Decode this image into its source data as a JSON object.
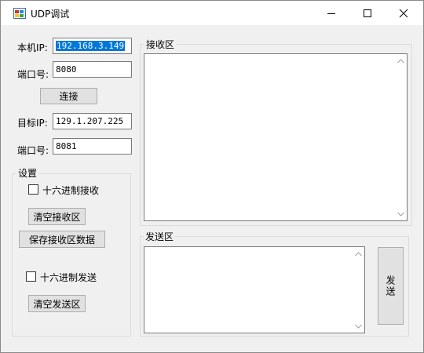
{
  "window": {
    "title": "UDP调试"
  },
  "left": {
    "local_ip_label": "本机IP:",
    "local_ip_value": "192.168.3.149",
    "local_port_label": "端口号:",
    "local_port_value": "8080",
    "connect_label": "连接",
    "target_ip_label": "目标IP:",
    "target_ip_value": "129.1.207.225",
    "target_port_label": "端口号:",
    "target_port_value": "8081"
  },
  "settings": {
    "title": "设置",
    "hex_receive_label": "十六进制接收",
    "hex_receive_checked": false,
    "clear_receive_label": "清空接收区",
    "save_receive_label": "保存接收区数据",
    "hex_send_label": "十六进制发送",
    "hex_send_checked": false,
    "clear_send_label": "清空发送区"
  },
  "receive": {
    "title": "接收区",
    "content": ""
  },
  "send": {
    "title": "发送区",
    "content": "",
    "send_label": "发送"
  },
  "colors": {
    "selection": "#0078d7",
    "window_bg": "#f0f0f0",
    "button_bg": "#e1e1e1"
  }
}
